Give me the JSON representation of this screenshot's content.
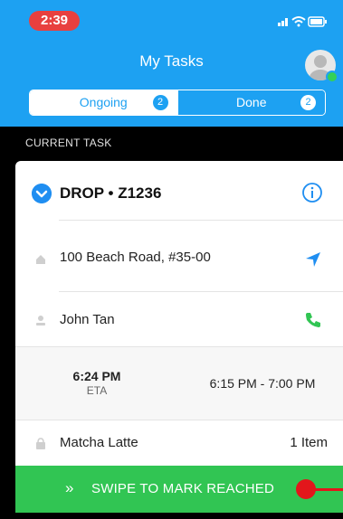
{
  "status_bar": {
    "time": "2:39",
    "accent": "#e8403f"
  },
  "header": {
    "title": "My Tasks",
    "background": "#1da1f2"
  },
  "tabs": [
    {
      "label": "Ongoing",
      "count": "2",
      "active": true
    },
    {
      "label": "Done",
      "count": "2",
      "active": false
    }
  ],
  "section_label": "CURRENT TASK",
  "task": {
    "title": "DROP • Z1236",
    "address": "100 Beach Road, #35-00",
    "contact_name": "John Tan",
    "eta_time": "6:24 PM",
    "eta_label": "ETA",
    "time_window": "6:15 PM  -  7:00 PM",
    "item_name": "Matcha Latte",
    "item_count": "1 Item",
    "icons": {
      "type": "chevron-down-icon",
      "info": "info-icon",
      "address": "home-icon",
      "navigate": "navigation-arrow-icon",
      "contact": "person-icon",
      "call": "phone-icon",
      "item": "bag-icon"
    }
  },
  "swipe": {
    "label": "SWIPE TO MARK REACHED",
    "chevrons": "»",
    "color": "#31c553",
    "knob_color": "#e3161b"
  }
}
